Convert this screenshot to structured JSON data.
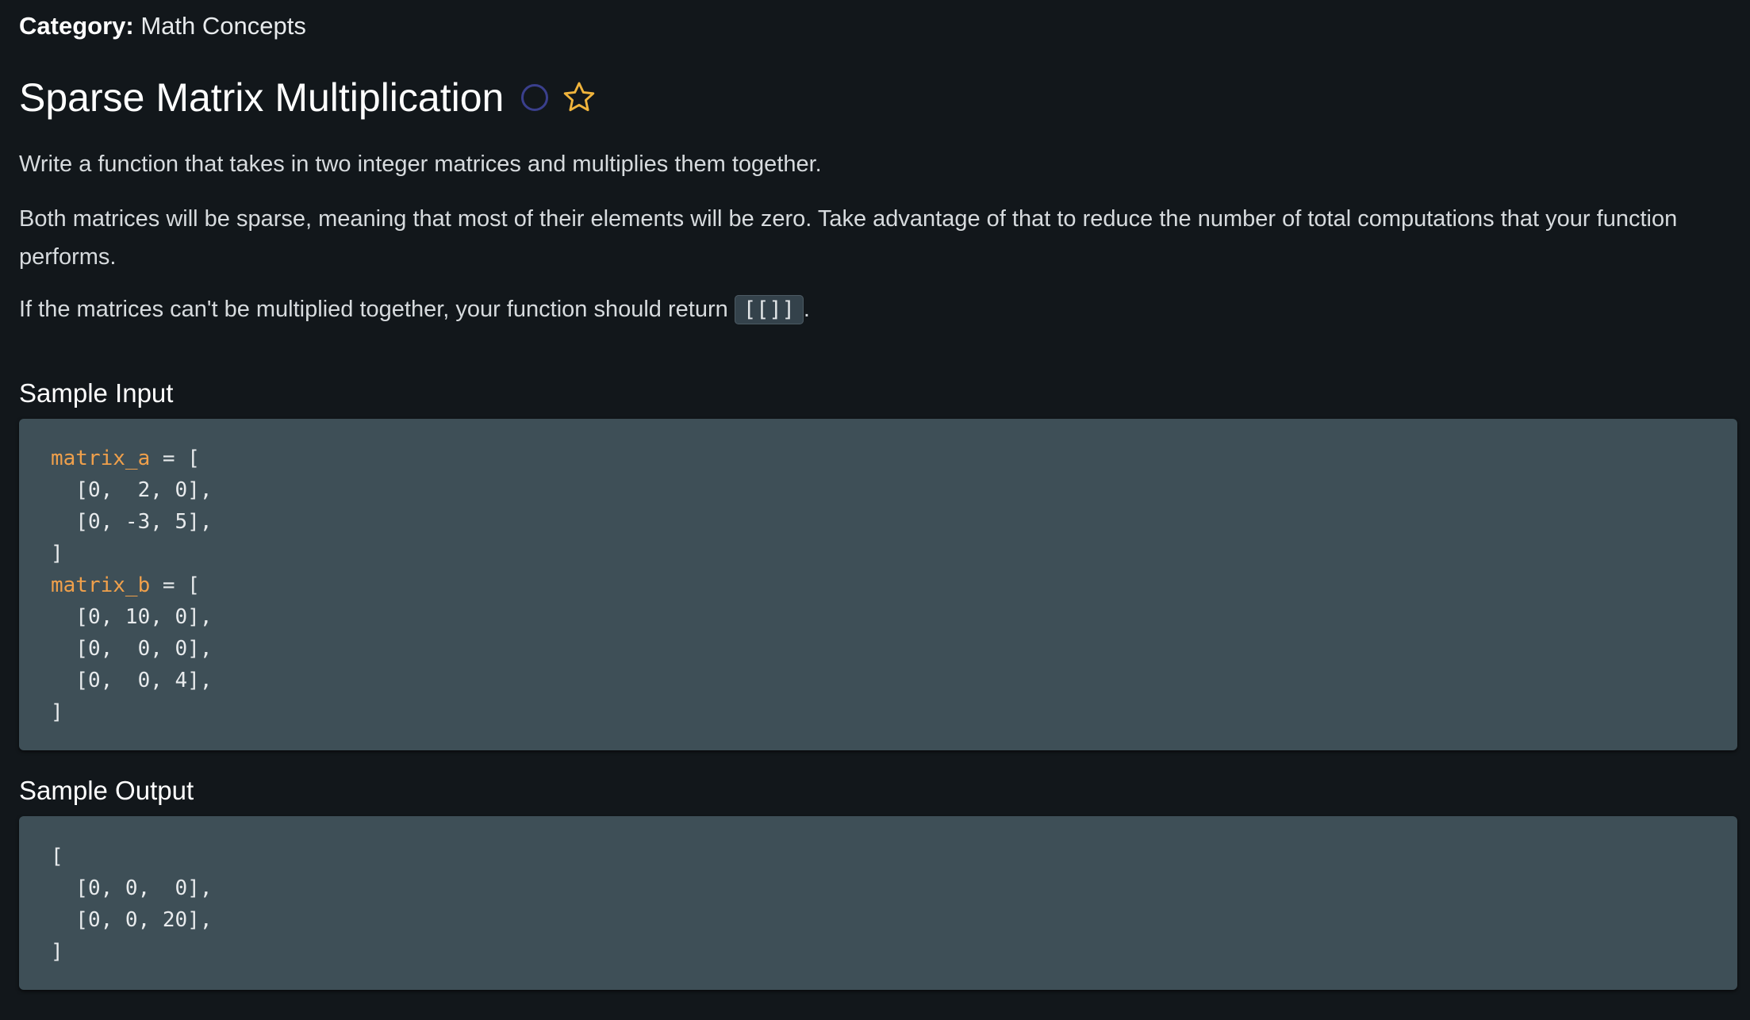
{
  "category": {
    "label": "Category:",
    "value": "Math Concepts"
  },
  "question": {
    "title": "Sparse Matrix Multiplication",
    "status_icon": "circle-icon",
    "favorite_icon": "star-icon",
    "colors": {
      "status_circle": "#3a3f8c",
      "star": "#f0b43c",
      "variable": "#f0a04b"
    }
  },
  "description": {
    "p1": "Write a function that takes in two integer matrices and multiplies them together.",
    "p2": "Both matrices will be sparse, meaning that most of their elements will be zero. Take advantage of that to reduce the number of total computations that your function performs.",
    "p3_before": "If the matrices can't be multiplied together, your function should return ",
    "p3_code": "[[]]",
    "p3_after": "."
  },
  "sample_input": {
    "heading": "Sample Input",
    "lines": [
      {
        "var": "matrix_a",
        "rest": " = ["
      },
      {
        "var": "",
        "rest": "  [0,  2, 0],"
      },
      {
        "var": "",
        "rest": "  [0, -3, 5],"
      },
      {
        "var": "",
        "rest": "]"
      },
      {
        "var": "matrix_b",
        "rest": " = ["
      },
      {
        "var": "",
        "rest": "  [0, 10, 0],"
      },
      {
        "var": "",
        "rest": "  [0,  0, 0],"
      },
      {
        "var": "",
        "rest": "  [0,  0, 4],"
      },
      {
        "var": "",
        "rest": "]"
      }
    ]
  },
  "sample_output": {
    "heading": "Sample Output",
    "lines": [
      {
        "var": "",
        "rest": "["
      },
      {
        "var": "",
        "rest": "  [0, 0,  0],"
      },
      {
        "var": "",
        "rest": "  [0, 0, 20],"
      },
      {
        "var": "",
        "rest": "]"
      }
    ]
  }
}
